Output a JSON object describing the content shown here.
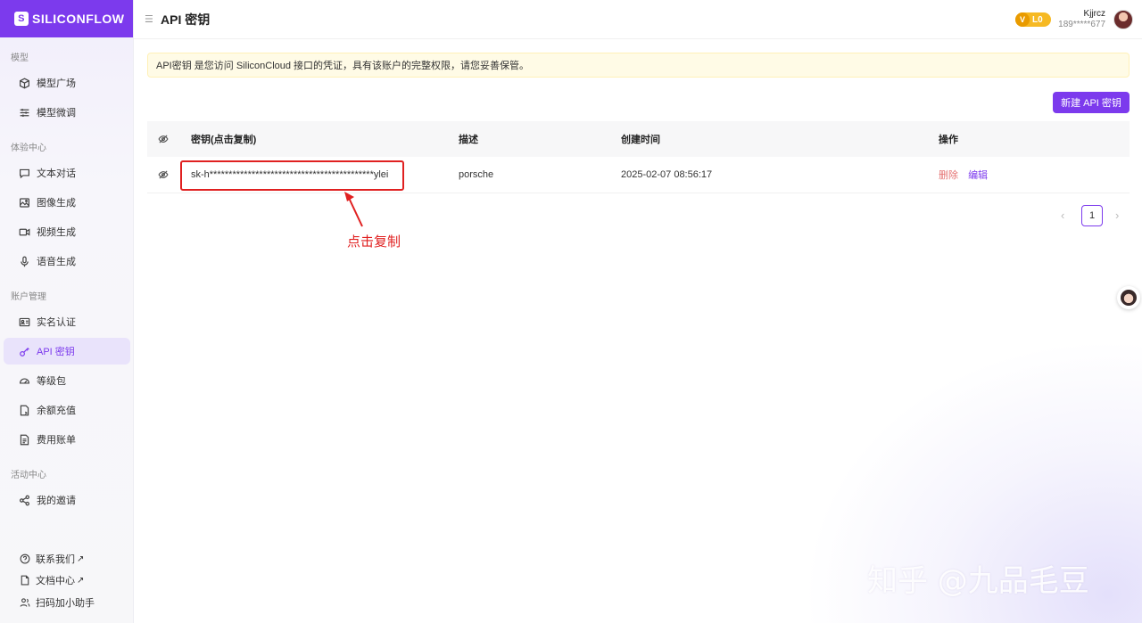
{
  "brand": {
    "logo_text": "SILICONFLOW"
  },
  "sidebar": {
    "sections": [
      {
        "label": "模型"
      },
      {
        "label": "体验中心"
      },
      {
        "label": "账户管理"
      },
      {
        "label": "活动中心"
      }
    ],
    "items": [
      {
        "label": "模型广场",
        "icon": "cube-icon"
      },
      {
        "label": "模型微调",
        "icon": "sliders-icon"
      },
      {
        "label": "文本对话",
        "icon": "chat-icon"
      },
      {
        "label": "图像生成",
        "icon": "image-icon"
      },
      {
        "label": "视频生成",
        "icon": "video-icon"
      },
      {
        "label": "语音生成",
        "icon": "mic-icon"
      },
      {
        "label": "实名认证",
        "icon": "id-card-icon"
      },
      {
        "label": "API 密钥",
        "icon": "key-icon",
        "active": true
      },
      {
        "label": "等级包",
        "icon": "gauge-icon"
      },
      {
        "label": "余额充值",
        "icon": "wallet-icon"
      },
      {
        "label": "费用账单",
        "icon": "bill-icon"
      },
      {
        "label": "我的邀请",
        "icon": "share-icon"
      }
    ],
    "footer": [
      {
        "label": "联系我们",
        "ext": "↗"
      },
      {
        "label": "文档中心",
        "ext": "↗"
      },
      {
        "label": "扫码加小助手"
      }
    ]
  },
  "header": {
    "title": "API 密钥",
    "level": "L0",
    "level_mark": "V",
    "user_name": "Kjjrcz",
    "user_phone": "189*****677"
  },
  "notice": "API密钥 是您访问 SiliconCloud 接口的凭证，具有该账户的完整权限，请您妥善保管。",
  "new_key_button": "新建 API 密钥",
  "table": {
    "headers": [
      "密钥(点击复制)",
      "描述",
      "创建时间",
      "操作"
    ],
    "rows": [
      {
        "key": "sk-h*******************************************ylei",
        "description": "porsche",
        "created": "2025-02-07 08:56:17",
        "delete": "删除",
        "edit": "编辑"
      }
    ]
  },
  "pagination": {
    "current": "1",
    "prev": "‹",
    "next": "›"
  },
  "annotation": "点击复制",
  "watermark": "知乎 @九品毛豆",
  "colors": {
    "accent": "#7c3aed",
    "annotation": "#e02020",
    "danger": "#e57373",
    "badge": "#f6b923"
  }
}
